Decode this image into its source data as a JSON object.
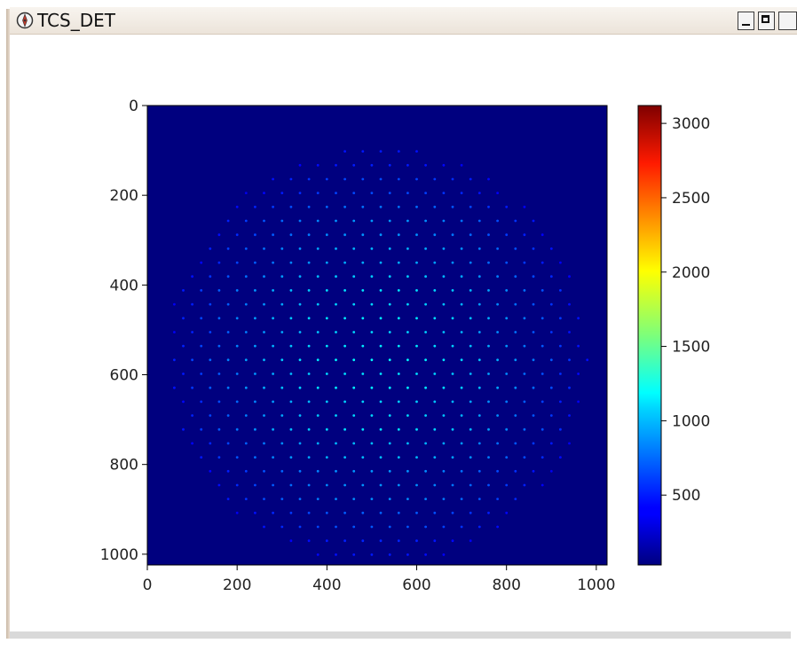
{
  "window": {
    "title": "TCS_DET",
    "icon": "compass-icon",
    "buttons": {
      "minimize": "minimize-icon",
      "maximize": "maximize-icon",
      "close": "close-icon"
    }
  },
  "colors": {
    "background_field": "#00007f",
    "titlebar": "#ece4da"
  },
  "chart_data": {
    "type": "heatmap",
    "title": "",
    "xlabel": "",
    "ylabel": "",
    "x_range": [
      0,
      1024
    ],
    "y_range": [
      0,
      1024
    ],
    "y_inverted": true,
    "x_ticks": [
      {
        "value": 0,
        "label": "0"
      },
      {
        "value": 200,
        "label": "200"
      },
      {
        "value": 400,
        "label": "400"
      },
      {
        "value": 600,
        "label": "600"
      },
      {
        "value": 800,
        "label": "800"
      },
      {
        "value": 1000,
        "label": "1000"
      }
    ],
    "y_ticks": [
      {
        "value": 0,
        "label": "0"
      },
      {
        "value": 200,
        "label": "200"
      },
      {
        "value": 400,
        "label": "400"
      },
      {
        "value": 600,
        "label": "600"
      },
      {
        "value": 800,
        "label": "800"
      },
      {
        "value": 1000,
        "label": "1000"
      }
    ],
    "colormap": "jet",
    "value_range": [
      30,
      3120
    ],
    "colorbar_ticks": [
      {
        "value": 500,
        "label": "500"
      },
      {
        "value": 1000,
        "label": "1000"
      },
      {
        "value": 1500,
        "label": "1500"
      },
      {
        "value": 2000,
        "label": "2000"
      },
      {
        "value": 2500,
        "label": "2500"
      },
      {
        "value": 3000,
        "label": "3000"
      }
    ],
    "background_value": 30,
    "spot_grid": {
      "center": [
        512,
        560
      ],
      "radius": 470,
      "pitch": 40,
      "row_spacing": 31,
      "peak_value": 1100,
      "edge_value": 350
    }
  }
}
